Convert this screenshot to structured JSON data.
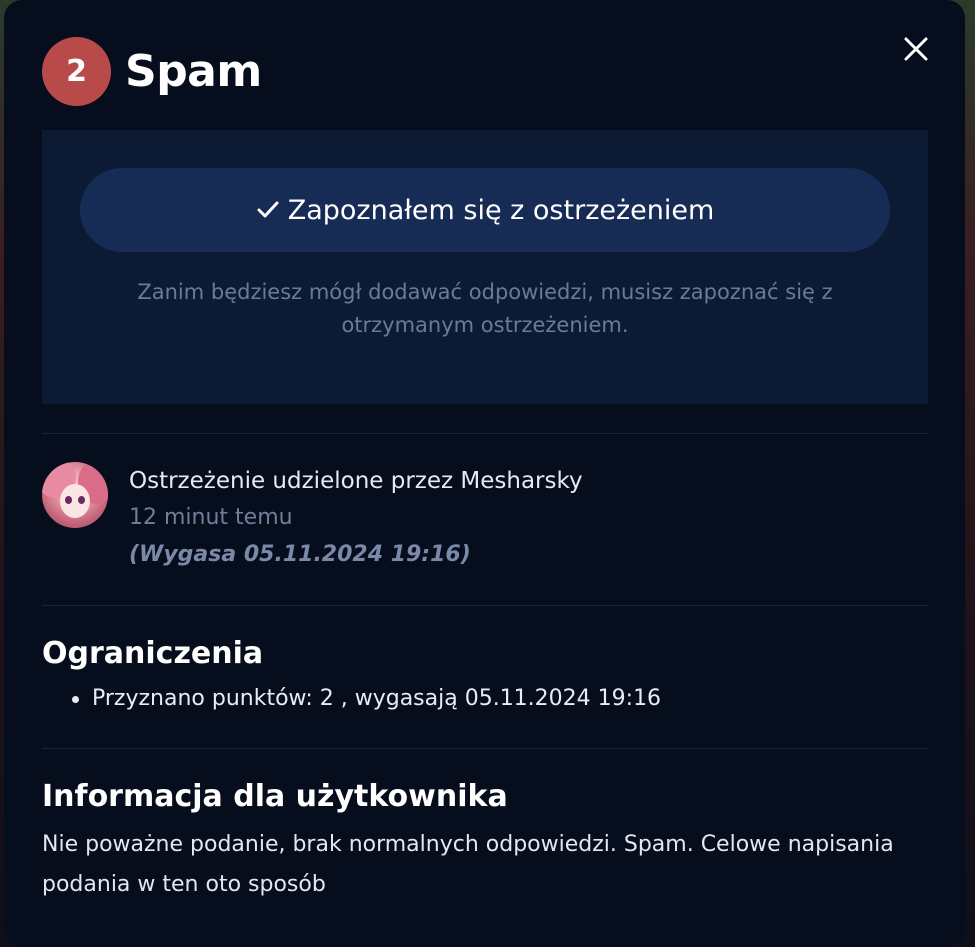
{
  "header": {
    "badge_count": "2",
    "title": "Spam"
  },
  "acknowledge": {
    "button_label": "Zapoznałem się z ostrzeżeniem",
    "notice": "Zanim będziesz mógł dodawać odpowiedzi, musisz zapoznać się z otrzymanym ostrzeżeniem."
  },
  "issuer": {
    "line": "Ostrzeżenie udzielone przez Mesharsky",
    "time_ago": "12 minut temu",
    "expires": "(Wygasa 05.11.2024 19:16)"
  },
  "restrictions": {
    "title": "Ograniczenia",
    "items": [
      "Przyznano punktów: 2 , wygasają 05.11.2024 19:16"
    ]
  },
  "user_info": {
    "title": "Informacja dla użytkownika",
    "text": "Nie poważne podanie, brak normalnych odpowiedzi. Spam. Celowe napisania podania w ten oto sposób"
  },
  "colors": {
    "modal_bg": "#060d1c",
    "badge": "#b94a4a",
    "button": "#172c55",
    "warn_box": "#0d1a33"
  },
  "icons": {
    "close": "close-icon",
    "check": "check-icon",
    "avatar": "avatar"
  }
}
